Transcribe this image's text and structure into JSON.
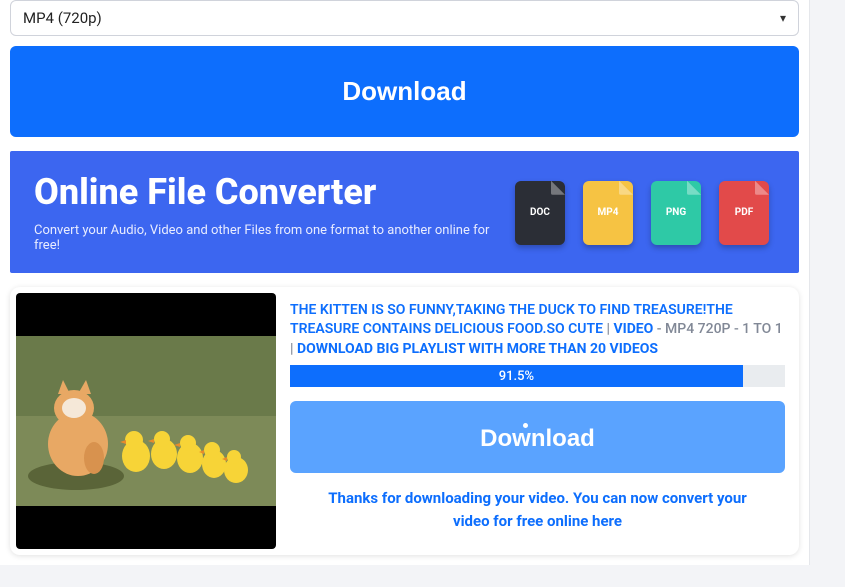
{
  "format_select": {
    "value": "MP4 (720p)"
  },
  "main_download_label": "Download",
  "banner": {
    "title": "Online File Converter",
    "subtitle": "Convert your Audio, Video and other Files from one format to another online for free!",
    "icons": [
      "DOC",
      "MP4",
      "PNG",
      "PDF"
    ]
  },
  "card": {
    "title_part1": "THE KITTEN IS SO FUNNY,TAKING THE DUCK TO FIND TREASURE!THE TREASURE CONTAINS DELICIOUS FOOD.SO CUTE",
    "sep1": " | ",
    "video_label": "VIDEO",
    "meta": " - MP4 720P - 1 TO 1",
    "sep2": " | ",
    "playlist_link": "DOWNLOAD BIG PLAYLIST WITH MORE THAN 20 VIDEOS",
    "progress_percent": 91.5,
    "progress_label": "91.5%",
    "download_label": "Download",
    "thanks": "Thanks for downloading your video. You can now convert your video for free online here"
  }
}
